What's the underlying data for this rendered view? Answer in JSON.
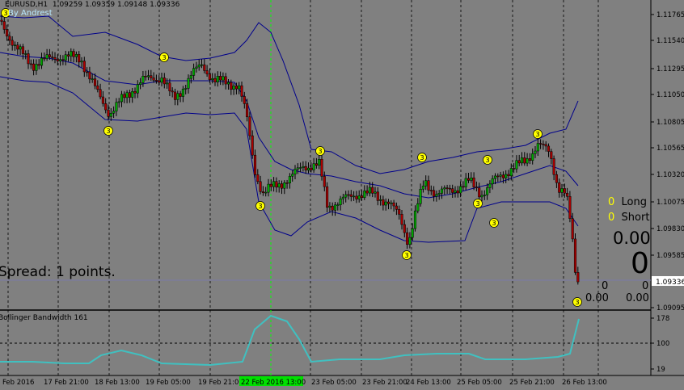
{
  "header": {
    "symbol": "EURUSD,H1",
    "ohlc": "1.09259 1.09359 1.09148 1.09336",
    "author": "By Andrest"
  },
  "spread": "Spread: 1 points.",
  "indicator": {
    "name": "Bollinger Bandwidth 161"
  },
  "positions": {
    "long_count": "0",
    "long_label": "Long",
    "short_count": "0",
    "short_label": "Short",
    "total_profit": "0.00",
    "total_count": "0",
    "row_a_count": "0",
    "row_a_profit": "0.00",
    "row_b_count": "0",
    "row_b_profit": "0.00"
  },
  "current_price": "1.09336",
  "price_axis": [
    "1.11765",
    "1.11540",
    "1.11295",
    "1.11050",
    "1.10805",
    "1.10565",
    "1.10320",
    "1.10075",
    "1.09830",
    "1.09585",
    "1.09336",
    "1.09095"
  ],
  "ind_axis": [
    "178",
    "100",
    "19"
  ],
  "time_axis": [
    "Feb 2016",
    "17 Feb 21:00",
    "18 Feb 13:00",
    "19 Feb 05:00",
    "19 Feb 21:00",
    "20 Feb 13:00",
    "23 Feb 05:00",
    "23 Feb 21:00",
    "24 Feb 13:00",
    "25 Feb 05:00",
    "25 Feb 21:00",
    "26 Feb 13:00"
  ],
  "crosshair_time": "22 Feb 2016 13:00",
  "markers": [
    "3",
    "3",
    "3",
    "3",
    "3",
    "3",
    "3",
    "3",
    "3",
    "3",
    "3",
    "3"
  ],
  "colors": {
    "bg": "#808080",
    "bull": "#00aa00",
    "bear": "#aa0000",
    "band": "#00008b",
    "bandwidth": "#40c0c0",
    "marker": "#ffff00",
    "crosshair": "#00ff00"
  }
}
